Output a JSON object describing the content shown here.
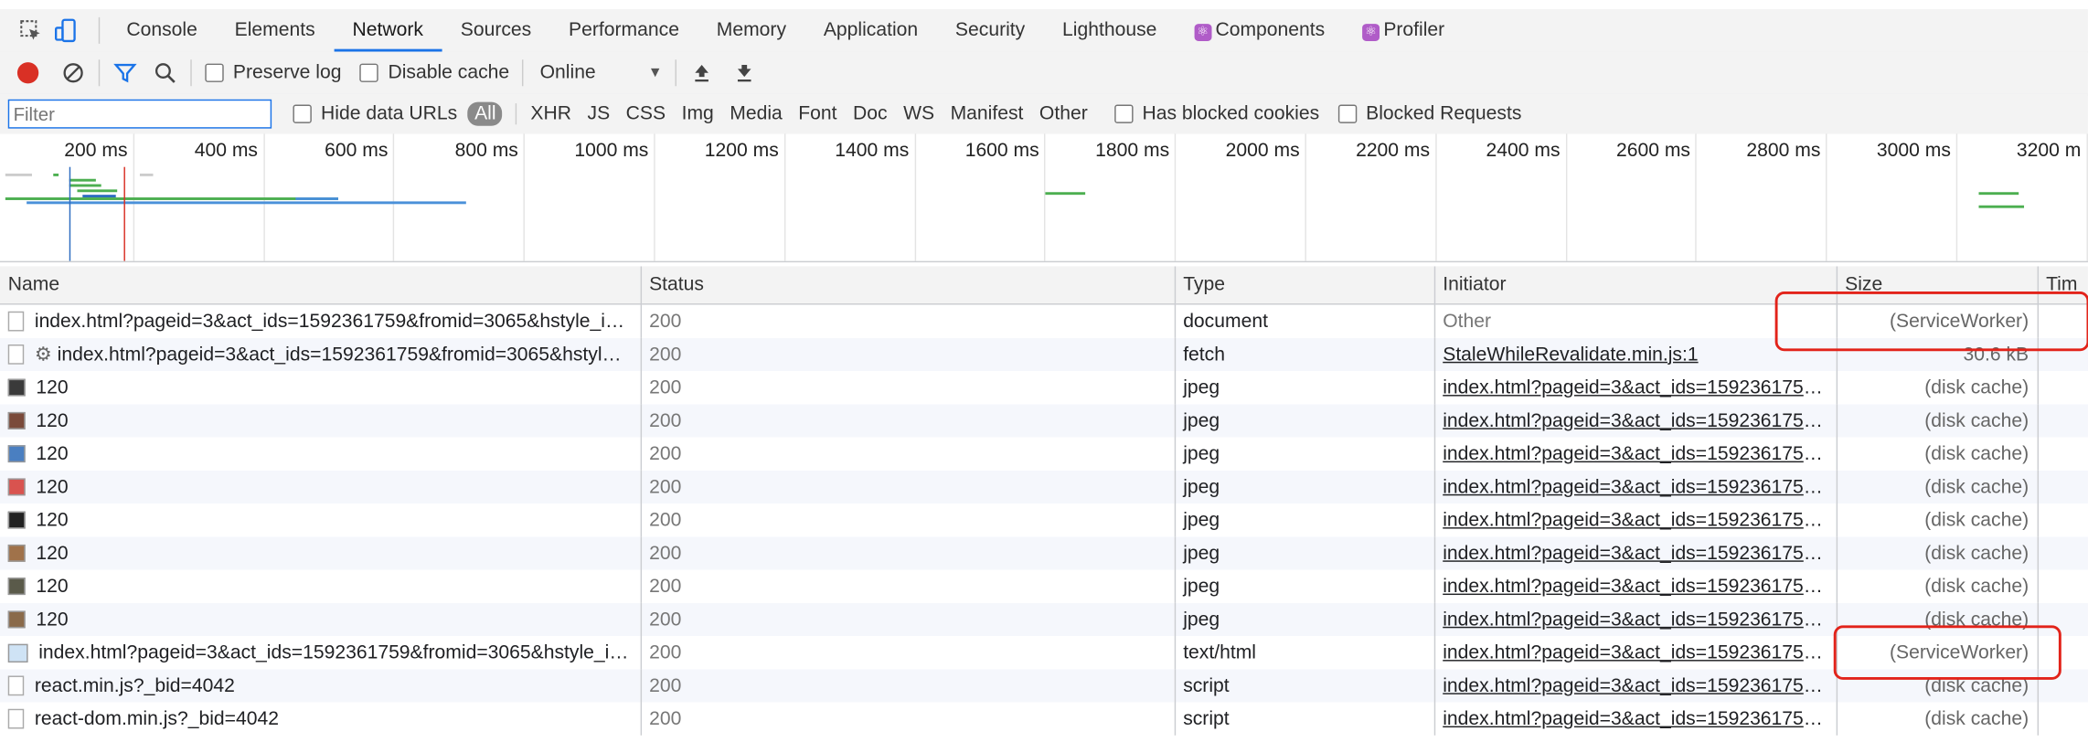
{
  "tabs": [
    "Console",
    "Elements",
    "Network",
    "Sources",
    "Performance",
    "Memory",
    "Application",
    "Security",
    "Lighthouse",
    "Components",
    "Profiler"
  ],
  "toolbar": {
    "preserve_log": "Preserve log",
    "disable_cache": "Disable cache",
    "throttle": "Online"
  },
  "filter": {
    "placeholder": "Filter",
    "hide_data_urls": "Hide data URLs",
    "all": "All",
    "types": [
      "XHR",
      "JS",
      "CSS",
      "Img",
      "Media",
      "Font",
      "Doc",
      "WS",
      "Manifest",
      "Other"
    ],
    "blocked_cookies": "Has blocked cookies",
    "blocked_requests": "Blocked Requests"
  },
  "overview_ticks": [
    "200 ms",
    "400 ms",
    "600 ms",
    "800 ms",
    "1000 ms",
    "1200 ms",
    "1400 ms",
    "1600 ms",
    "1800 ms",
    "2000 ms",
    "2200 ms",
    "2400 ms",
    "2600 ms",
    "2800 ms",
    "3000 ms",
    "3200 m"
  ],
  "columns": {
    "name": "Name",
    "status": "Status",
    "type": "Type",
    "initiator": "Initiator",
    "size": "Size",
    "time": "Tim"
  },
  "rows": [
    {
      "name": "index.html?pageid=3&act_ids=1592361759&fromid=3065&hstyle_i…",
      "status": "200",
      "type": "document",
      "initiator": "Other",
      "size": "(ServiceWorker)",
      "icon": "doc"
    },
    {
      "name": "index.html?pageid=3&act_ids=1592361759&fromid=3065&hstyl…",
      "status": "200",
      "type": "fetch",
      "initiator": "StaleWhileRevalidate.min.js:1",
      "size": "30.6 kB",
      "icon": "gear"
    },
    {
      "name": "120",
      "status": "200",
      "type": "jpeg",
      "initiator": "index.html?pageid=3&act_ids=1592361759…",
      "size": "(disk cache)",
      "icon": "img",
      "color": "#3a3a3a"
    },
    {
      "name": "120",
      "status": "200",
      "type": "jpeg",
      "initiator": "index.html?pageid=3&act_ids=1592361759…",
      "size": "(disk cache)",
      "icon": "img",
      "color": "#7a4a3a"
    },
    {
      "name": "120",
      "status": "200",
      "type": "jpeg",
      "initiator": "index.html?pageid=3&act_ids=1592361759…",
      "size": "(disk cache)",
      "icon": "img",
      "color": "#4a7fc1"
    },
    {
      "name": "120",
      "status": "200",
      "type": "jpeg",
      "initiator": "index.html?pageid=3&act_ids=1592361759…",
      "size": "(disk cache)",
      "icon": "img",
      "color": "#d9534f"
    },
    {
      "name": "120",
      "status": "200",
      "type": "jpeg",
      "initiator": "index.html?pageid=3&act_ids=1592361759…",
      "size": "(disk cache)",
      "icon": "img",
      "color": "#222222"
    },
    {
      "name": "120",
      "status": "200",
      "type": "jpeg",
      "initiator": "index.html?pageid=3&act_ids=1592361759…",
      "size": "(disk cache)",
      "icon": "img",
      "color": "#a0724a"
    },
    {
      "name": "120",
      "status": "200",
      "type": "jpeg",
      "initiator": "index.html?pageid=3&act_ids=1592361759…",
      "size": "(disk cache)",
      "icon": "img",
      "color": "#5a5a4a"
    },
    {
      "name": "120",
      "status": "200",
      "type": "jpeg",
      "initiator": "index.html?pageid=3&act_ids=1592361759…",
      "size": "(disk cache)",
      "icon": "img",
      "color": "#8a6a4a"
    },
    {
      "name": "index.html?pageid=3&act_ids=1592361759&fromid=3065&hstyle_i…",
      "status": "200",
      "type": "text/html",
      "initiator": "index.html?pageid=3&act_ids=1592361759…",
      "size": "(ServiceWorker)",
      "icon": "html"
    },
    {
      "name": "react.min.js?_bid=4042",
      "status": "200",
      "type": "script",
      "initiator": "index.html?pageid=3&act_ids=1592361759…",
      "size": "(disk cache)",
      "icon": "doc"
    },
    {
      "name": "react-dom.min.js?_bid=4042",
      "status": "200",
      "type": "script",
      "initiator": "index.html?pageid=3&act_ids=1592361759…",
      "size": "(disk cache)",
      "icon": "doc"
    }
  ],
  "colors": {
    "accent": "#1a73e8",
    "record": "#d93025",
    "highlight": "#e2231a"
  }
}
